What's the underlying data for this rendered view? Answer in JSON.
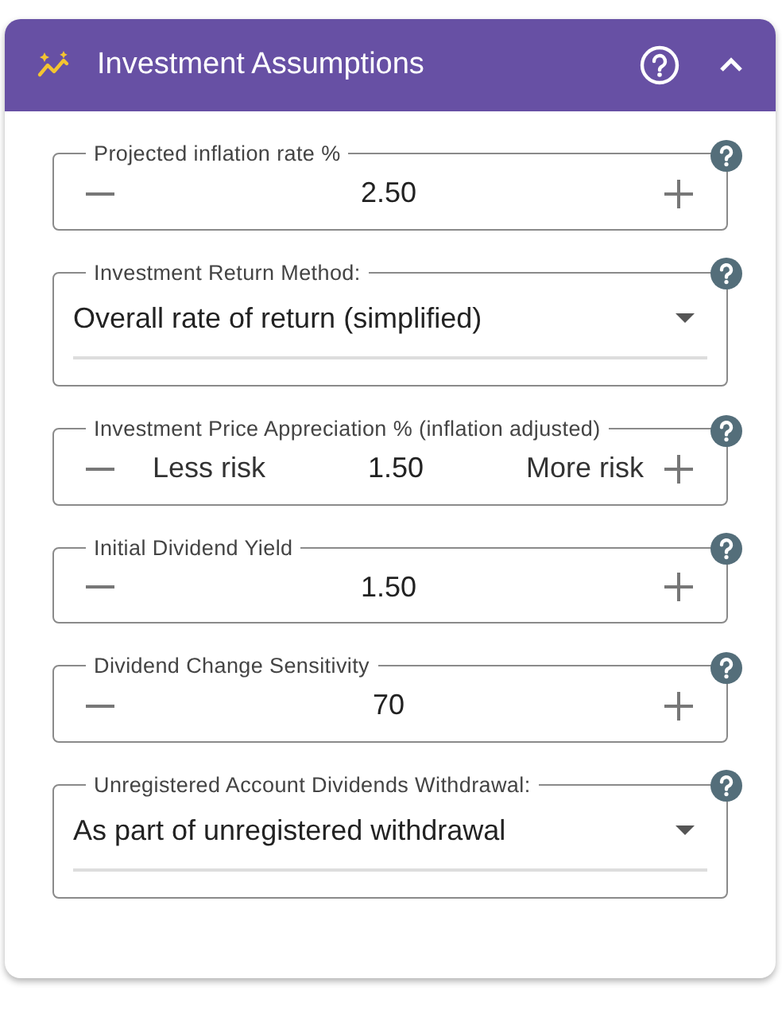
{
  "panel": {
    "title": "Investment Assumptions",
    "expanded": true
  },
  "fields": [
    {
      "kind": "stepper",
      "label": "Projected inflation rate %",
      "value": "2.50"
    },
    {
      "kind": "select",
      "label": "Investment Return Method:",
      "value": "Overall rate of return (simplified)"
    },
    {
      "kind": "stepper",
      "label": "Investment Price Appreciation % (inflation adjusted)",
      "value": "1.50",
      "low_label": "Less risk",
      "high_label": "More risk"
    },
    {
      "kind": "stepper",
      "label": "Initial Dividend Yield",
      "value": "1.50"
    },
    {
      "kind": "stepper",
      "label": "Dividend Change Sensitivity",
      "value": "70"
    },
    {
      "kind": "select",
      "label": "Unregistered Account Dividends Withdrawal:",
      "value": "As part of unregistered withdrawal"
    }
  ]
}
